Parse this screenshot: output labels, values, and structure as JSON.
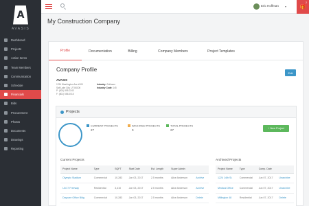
{
  "app": {
    "brand": "AVASIS",
    "logo_letter": "A"
  },
  "sidebar": {
    "items": [
      {
        "label": "Dashboard",
        "icon": "dashboard-icon"
      },
      {
        "label": "Projects",
        "icon": "projects-icon"
      },
      {
        "label": "Action Items",
        "icon": "action-items-icon"
      },
      {
        "label": "Team Members",
        "icon": "team-icon"
      },
      {
        "label": "Communication",
        "icon": "communication-icon"
      },
      {
        "label": "Schedule",
        "icon": "schedule-icon"
      },
      {
        "label": "Financials",
        "icon": "financials-icon",
        "active": true
      },
      {
        "label": "Bids",
        "icon": "bids-icon"
      },
      {
        "label": "Procurement",
        "icon": "procurement-icon"
      },
      {
        "label": "Photos",
        "icon": "photos-icon"
      },
      {
        "label": "Documents",
        "icon": "documents-icon"
      },
      {
        "label": "Drawings",
        "icon": "drawings-icon"
      },
      {
        "label": "Reporting",
        "icon": "reporting-icon"
      }
    ]
  },
  "topbar": {
    "user_name": "Eric Hoffman",
    "notification_count": "2"
  },
  "page": {
    "title": "My Construction Company"
  },
  "tabs": [
    "Profile",
    "Documentation",
    "Billing",
    "Company Members",
    "Project Templates"
  ],
  "profile": {
    "title": "Company Profile",
    "edit_label": "Edit",
    "company_name": "AVASIS",
    "address_line1": "1234 Washington Ave #100",
    "address_line2": "Salt Lake City, UT 84106",
    "phone1": "P: (801) 555-2243",
    "phone2": "F: (801) 555-0015",
    "industry_label": "Industry:",
    "industry_value": "Software",
    "industry_code_label": "Industry Code:",
    "industry_code_value": "145"
  },
  "projects": {
    "title": "Projects",
    "stats": [
      {
        "label": "CURRENT PROJECTS",
        "value": "27",
        "color": "#3c96c8"
      },
      {
        "label": "ARCHIVED PROJECTS",
        "value": "0",
        "color": "#f0ad4e"
      },
      {
        "label": "TOTAL PROJECTS",
        "value": "27",
        "color": "#5cb85c"
      }
    ],
    "new_project_label": "+ New Project",
    "current_label": "Current Projects",
    "archived_label": "Archived Projects",
    "current_columns": [
      "Project Name",
      "Type",
      "SQFT",
      "Start Date",
      "Est. Length",
      "Super Admin",
      ""
    ],
    "current_rows": [
      [
        "Olympic Stadium",
        "Commercial",
        "10,283",
        "Jun 03, 2017",
        "2.5 months",
        "Alice Anderson",
        "Archive"
      ],
      [
        "I-5/17 Freeway",
        "Residential",
        "3,410",
        "Jun 03, 2017",
        "2.5 months",
        "Alice Anderson",
        "Archive"
      ],
      [
        "Daycare Office Bldg",
        "Commercial",
        "10,283",
        "Jun 03, 2017",
        "2.5 months",
        "Alice Anderson",
        "Delete"
      ]
    ],
    "archived_columns": [
      "Project Name",
      "Type",
      "Comp. Date",
      ""
    ],
    "archived_rows": [
      [
        "1224 14th St.",
        "Commercial",
        "Jun 07, 2017",
        "Unarchive"
      ],
      [
        "Medical Office",
        "Commercial",
        "Jun 07, 2017",
        "Unarchive"
      ],
      [
        "Millington 48",
        "Residential",
        "Jun 07, 2017",
        "Delete"
      ]
    ]
  }
}
